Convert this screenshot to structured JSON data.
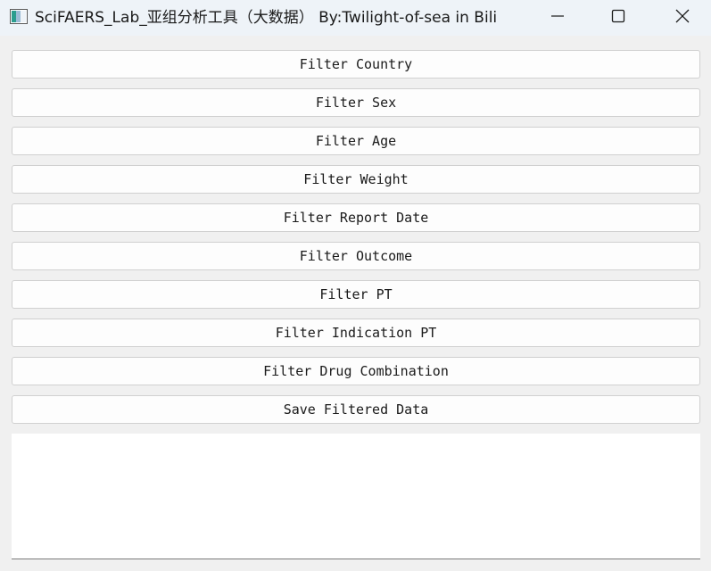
{
  "window": {
    "title": "SciFAERS_Lab_亚组分析工具（大数据） By:Twilight-of-sea in Bili"
  },
  "titlebar_icons": {
    "app": "app-window-icon",
    "minimize": "minimize-icon",
    "maximize": "maximize-icon",
    "close": "close-icon"
  },
  "buttons": {
    "filter_country": "Filter Country",
    "filter_sex": "Filter Sex",
    "filter_age": "Filter Age",
    "filter_weight": "Filter Weight",
    "filter_report_date": "Filter Report Date",
    "filter_outcome": "Filter Outcome",
    "filter_pt": "Filter PT",
    "filter_indication_pt": "Filter Indication PT",
    "filter_drug_combination": "Filter Drug Combination",
    "save_filtered_data": "Save Filtered Data"
  },
  "output": {
    "text": ""
  }
}
